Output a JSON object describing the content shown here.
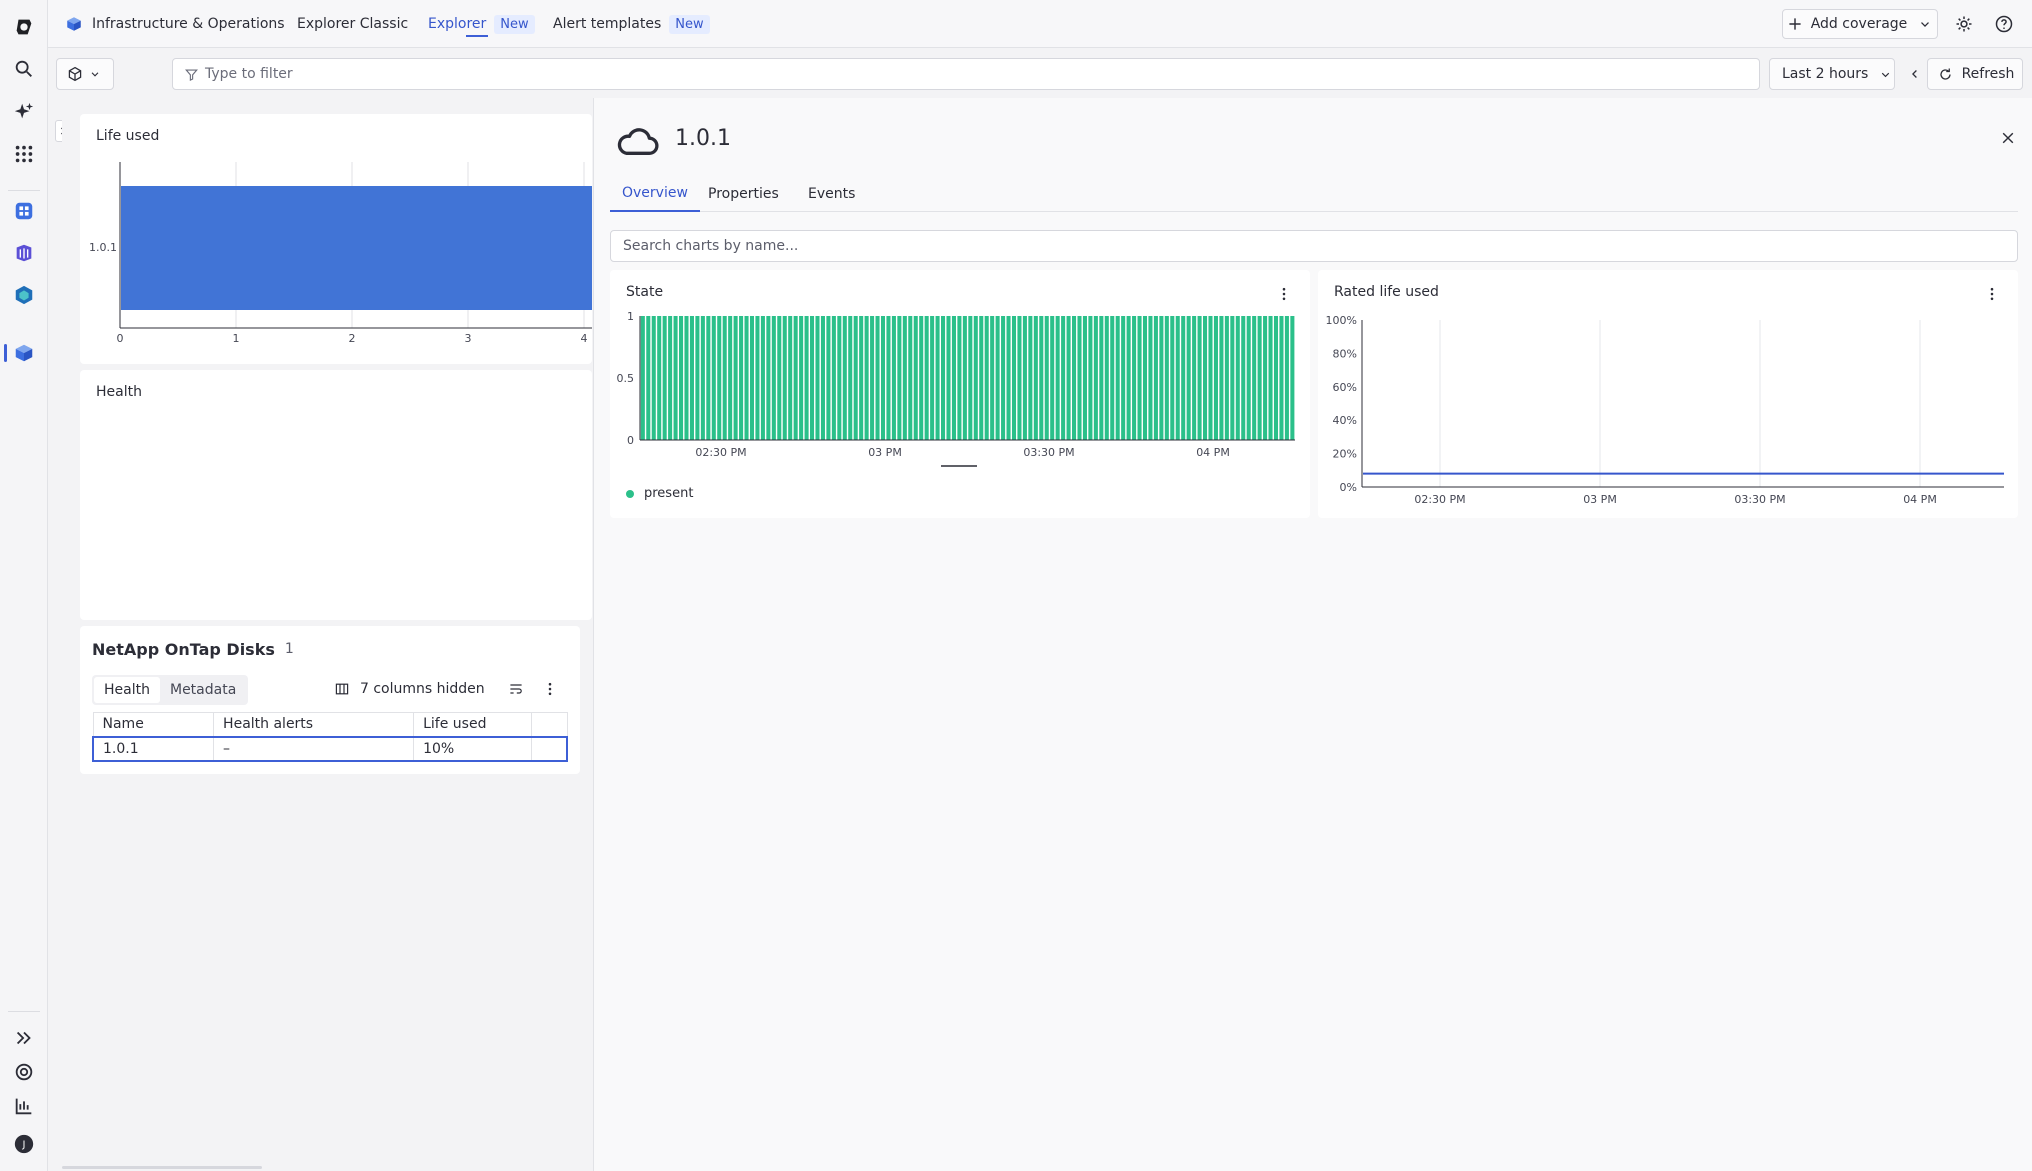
{
  "topbar": {
    "app_name": "Infrastructure & Operations",
    "tabs": [
      {
        "label": "Explorer Classic",
        "badge": ""
      },
      {
        "label": "Explorer",
        "badge": "New"
      },
      {
        "label": "Alert templates",
        "badge": "New"
      }
    ],
    "add_coverage": "Add coverage"
  },
  "filter": {
    "placeholder": "Type to filter",
    "timeframe": "Last 2 hours",
    "refresh": "Refresh"
  },
  "left": {
    "life_used_title": "Life used",
    "life_used_chart": {
      "type": "bar",
      "orientation": "horizontal",
      "categories": [
        "1.0.1"
      ],
      "values": [
        10
      ],
      "x_ticks": [
        "0",
        "1",
        "2",
        "3",
        "4"
      ]
    },
    "health_title": "Health",
    "table": {
      "title": "NetApp OnTap Disks",
      "count": "1",
      "tabs": [
        "Health",
        "Metadata"
      ],
      "columns_hidden": "7 columns hidden",
      "columns": [
        "Name",
        "Health alerts",
        "Life used"
      ],
      "rows": [
        [
          "1.0.1",
          "–",
          "10%"
        ]
      ]
    }
  },
  "detail": {
    "title": "1.0.1",
    "tabs": [
      "Overview",
      "Properties",
      "Events"
    ],
    "search_placeholder": "Search charts by name...",
    "state_card_title": "State",
    "rated_card_title": "Rated life used"
  },
  "chart_data": [
    {
      "type": "bar",
      "title": "State",
      "x_ticks": [
        "02:30 PM",
        "03 PM",
        "03:30 PM",
        "04 PM"
      ],
      "y_ticks": [
        "1",
        "0.5",
        "0"
      ],
      "ylim": [
        0,
        1
      ],
      "series": [
        {
          "name": "present",
          "color": "#2bc08a",
          "value_all_bars": 1,
          "bar_count": 120
        }
      ],
      "legend": "bottom-left"
    },
    {
      "type": "line",
      "title": "Rated life used",
      "x_ticks": [
        "02:30 PM",
        "03 PM",
        "03:30 PM",
        "04 PM"
      ],
      "y_ticks": [
        "100%",
        "80%",
        "60%",
        "40%",
        "20%",
        "0%"
      ],
      "ylim": [
        0,
        100
      ],
      "series": [
        {
          "color": "#3656cc",
          "value": 8
        }
      ]
    }
  ],
  "colors": {
    "accent": "#3d5fd6",
    "bar_blue": "#4174d6",
    "state_green": "#2bc08a"
  }
}
